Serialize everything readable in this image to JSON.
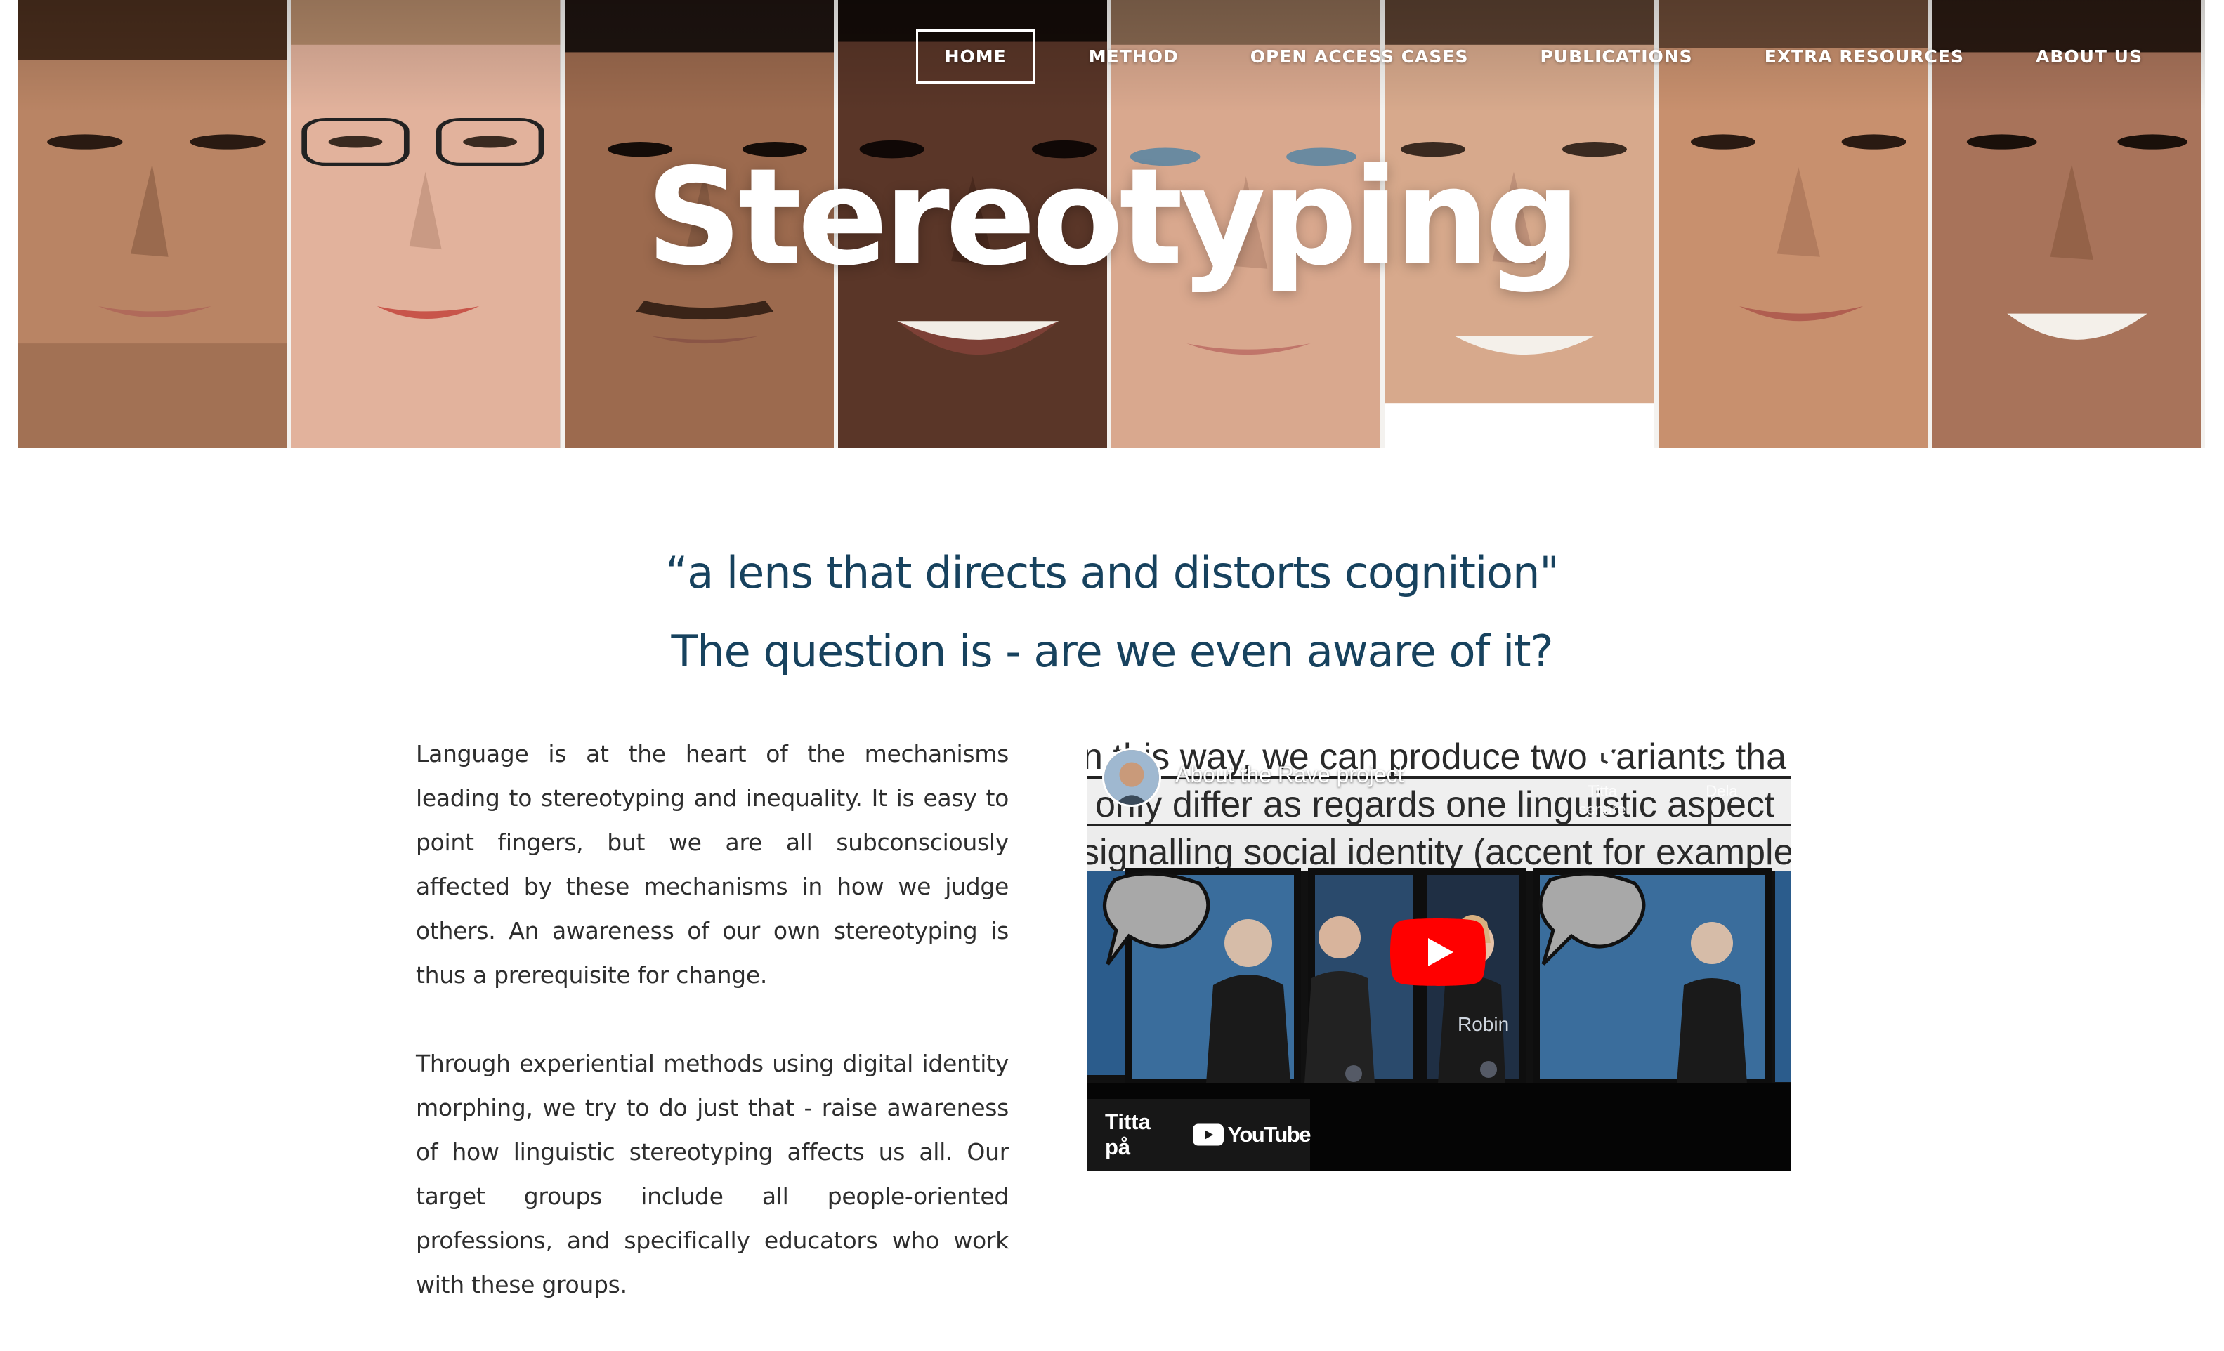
{
  "nav": {
    "items": [
      {
        "label": "HOME",
        "active": true
      },
      {
        "label": "METHOD"
      },
      {
        "label": "OPEN ACCESS CASES"
      },
      {
        "label": "PUBLICATIONS"
      },
      {
        "label": "EXTRA RESOURCES"
      },
      {
        "label": "ABOUT US"
      }
    ]
  },
  "hero": {
    "title": "Stereotyping",
    "faces": [
      {
        "skin": "#b98464",
        "hair": "#4a2e1d",
        "lips": "#b06a5a"
      },
      {
        "skin": "#e2b29c",
        "hair": "#b48a6a",
        "lips": "#c8554a"
      },
      {
        "skin": "#9c6a4e",
        "hair": "#1e1410",
        "lips": "#8a5546"
      },
      {
        "skin": "#5a3628",
        "hair": "#140c08",
        "lips": "#7d4036"
      },
      {
        "skin": "#d9a88e",
        "hair": "#8a6a52",
        "lips": "#c0756a"
      },
      {
        "skin": "#d7a98c",
        "hair": "#5a4030",
        "lips": "#b77a6a"
      },
      {
        "skin": "#c8906e",
        "hair": "#6b4a36",
        "lips": "#b05e50"
      },
      {
        "skin": "#a8735a",
        "hair": "#2a1a12",
        "lips": "#9a5a4c"
      }
    ]
  },
  "quote": {
    "line1": "“a lens that directs and distorts cognition\"",
    "line2": "The question is - are we even aware of it?"
  },
  "body": {
    "paragraph1": "Language is at the heart of the mechanisms leading to stereotyping and inequality. It is easy to point fingers, but we are all subconsciously affected by these mechanisms in how we judge others. An awareness of our own stereotyping is thus a prerequisite for change.",
    "paragraph2": "Through experiential methods using digital identity morphing, we try to do just that - raise awareness of how linguistic stereotyping affects us all. Our target groups include all people-oriented professions, and specifically educators who work with these groups."
  },
  "video": {
    "title": "About the Rave project",
    "caption_lines": [
      "n this way, we can produce two variants tha",
      "only differ as regards one linguistic aspect",
      "signalling social identity (accent for example)"
    ],
    "watch_later_label": "Titta senare",
    "share_label": "Dela",
    "speaker_name": "Robin",
    "watch_on_label": "Titta på",
    "youtube_label": "YouTube",
    "colors": {
      "play": "#ff0000",
      "panel": "#2b5c8c"
    }
  }
}
